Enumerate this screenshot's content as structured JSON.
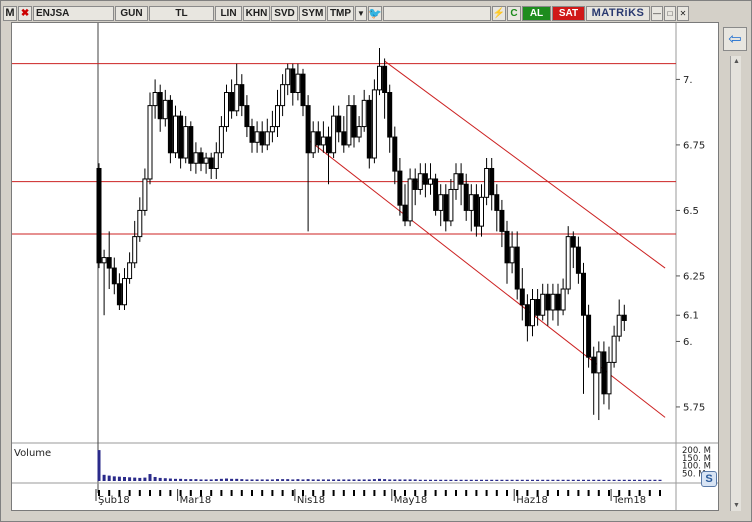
{
  "toolbar": {
    "logo": "M",
    "close_glyph": "✖",
    "symbol": "ENJSA",
    "period": "GUN",
    "currency": "TL",
    "scale_lin": "LIN",
    "khn": "KHN",
    "svd": "SVD",
    "sym": "SYM",
    "tmp": "TMP",
    "dropdown_glyph": "▼",
    "twitter_glyph": "🐦",
    "flash_glyph": "⚡",
    "refresh_glyph": "C",
    "buy_label": "AL",
    "sell_label": "SAT",
    "brand": "MATRiKS",
    "win_min": "—",
    "win_max": "□",
    "win_close": "✕"
  },
  "side_button_glyph": "⇦",
  "zoom_glyph": "S",
  "colors": {
    "candle": "#000000",
    "support_lines": "#cc2222",
    "channel_lines": "#cc2222",
    "volume_bars": "#2a2a8a",
    "grid": "#c0c0c0"
  },
  "chart_data": {
    "type": "candlestick",
    "price_axis": {
      "ticks": [
        7.0,
        6.75,
        6.5,
        6.25,
        6.1,
        6.0,
        5.75
      ],
      "tick_labels": [
        "7.",
        "6.75",
        "6.5",
        "6.25",
        "6.1",
        "6.",
        "5.75"
      ],
      "ylim": [
        5.62,
        7.2
      ]
    },
    "time_axis": {
      "labels": [
        "Şub18",
        "Mar18",
        "Nis18",
        "May18",
        "Haz18",
        "Tem18"
      ],
      "n_sessions": 111
    },
    "horizontal_levels": [
      7.06,
      6.61,
      6.41
    ],
    "channel": {
      "upper": [
        [
          56,
          7.07
        ],
        [
          111,
          6.28
        ]
      ],
      "lower": [
        [
          41,
          6.77
        ],
        [
          111,
          5.71
        ]
      ]
    },
    "candles": [
      [
        6.66,
        6.3,
        6.68,
        6.28
      ],
      [
        6.3,
        6.32,
        6.35,
        6.1
      ],
      [
        6.32,
        6.28,
        6.42,
        6.2
      ],
      [
        6.28,
        6.22,
        6.32,
        6.18
      ],
      [
        6.22,
        6.14,
        6.26,
        6.12
      ],
      [
        6.14,
        6.24,
        6.28,
        6.12
      ],
      [
        6.24,
        6.3,
        6.34,
        6.22
      ],
      [
        6.3,
        6.4,
        6.46,
        6.28
      ],
      [
        6.4,
        6.5,
        6.55,
        6.38
      ],
      [
        6.5,
        6.62,
        6.66,
        6.48
      ],
      [
        6.62,
        6.9,
        6.95,
        6.6
      ],
      [
        6.9,
        6.95,
        7.0,
        6.85
      ],
      [
        6.95,
        6.85,
        6.98,
        6.8
      ],
      [
        6.85,
        6.92,
        6.96,
        6.82
      ],
      [
        6.92,
        6.72,
        6.94,
        6.68
      ],
      [
        6.72,
        6.86,
        6.9,
        6.7
      ],
      [
        6.86,
        6.7,
        6.88,
        6.66
      ],
      [
        6.7,
        6.82,
        6.86,
        6.68
      ],
      [
        6.82,
        6.68,
        6.84,
        6.65
      ],
      [
        6.68,
        6.72,
        6.76,
        6.64
      ],
      [
        6.72,
        6.68,
        6.74,
        6.65
      ],
      [
        6.68,
        6.7,
        6.72,
        6.64
      ],
      [
        6.7,
        6.66,
        6.72,
        6.62
      ],
      [
        6.66,
        6.72,
        6.76,
        6.62
      ],
      [
        6.72,
        6.82,
        6.86,
        6.7
      ],
      [
        6.82,
        6.95,
        6.98,
        6.8
      ],
      [
        6.95,
        6.88,
        7.0,
        6.85
      ],
      [
        6.88,
        6.98,
        7.06,
        6.86
      ],
      [
        6.98,
        6.9,
        7.02,
        6.86
      ],
      [
        6.9,
        6.82,
        6.94,
        6.78
      ],
      [
        6.82,
        6.76,
        6.85,
        6.72
      ],
      [
        6.76,
        6.8,
        6.84,
        6.72
      ],
      [
        6.8,
        6.75,
        6.84,
        6.72
      ],
      [
        6.75,
        6.8,
        6.85,
        6.73
      ],
      [
        6.8,
        6.82,
        6.88,
        6.76
      ],
      [
        6.82,
        6.9,
        6.96,
        6.78
      ],
      [
        6.9,
        6.98,
        7.02,
        6.86
      ],
      [
        6.98,
        7.04,
        7.06,
        6.94
      ],
      [
        7.04,
        6.95,
        7.06,
        6.9
      ],
      [
        6.95,
        7.02,
        7.06,
        6.92
      ],
      [
        7.02,
        6.9,
        7.04,
        6.86
      ],
      [
        6.9,
        6.72,
        6.94,
        6.42
      ],
      [
        6.72,
        6.8,
        6.84,
        6.7
      ],
      [
        6.8,
        6.75,
        6.84,
        6.72
      ],
      [
        6.75,
        6.78,
        6.84,
        6.72
      ],
      [
        6.78,
        6.72,
        6.82,
        6.6
      ],
      [
        6.72,
        6.86,
        6.9,
        6.7
      ],
      [
        6.86,
        6.8,
        6.9,
        6.76
      ],
      [
        6.8,
        6.75,
        6.86,
        6.72
      ],
      [
        6.75,
        6.9,
        6.94,
        6.74
      ],
      [
        6.9,
        6.78,
        6.94,
        6.74
      ],
      [
        6.78,
        6.82,
        6.86,
        6.76
      ],
      [
        6.82,
        6.92,
        6.96,
        6.8
      ],
      [
        6.92,
        6.7,
        6.94,
        6.66
      ],
      [
        6.7,
        6.96,
        7.0,
        6.68
      ],
      [
        6.96,
        7.05,
        7.12,
        6.94
      ],
      [
        7.05,
        6.95,
        7.08,
        6.85
      ],
      [
        6.95,
        6.78,
        6.98,
        6.72
      ],
      [
        6.78,
        6.65,
        6.82,
        6.6
      ],
      [
        6.65,
        6.52,
        6.7,
        6.48
      ],
      [
        6.52,
        6.46,
        6.6,
        6.44
      ],
      [
        6.46,
        6.62,
        6.66,
        6.44
      ],
      [
        6.62,
        6.58,
        6.66,
        6.52
      ],
      [
        6.58,
        6.64,
        6.68,
        6.56
      ],
      [
        6.64,
        6.6,
        6.68,
        6.55
      ],
      [
        6.6,
        6.62,
        6.68,
        6.56
      ],
      [
        6.62,
        6.5,
        6.64,
        6.48
      ],
      [
        6.5,
        6.56,
        6.6,
        6.44
      ],
      [
        6.56,
        6.46,
        6.6,
        6.42
      ],
      [
        6.46,
        6.58,
        6.62,
        6.44
      ],
      [
        6.58,
        6.64,
        6.68,
        6.54
      ],
      [
        6.64,
        6.6,
        6.68,
        6.52
      ],
      [
        6.6,
        6.5,
        6.64,
        6.46
      ],
      [
        6.5,
        6.56,
        6.6,
        6.42
      ],
      [
        6.56,
        6.44,
        6.6,
        6.4
      ],
      [
        6.44,
        6.55,
        6.6,
        6.4
      ],
      [
        6.55,
        6.66,
        6.7,
        6.52
      ],
      [
        6.66,
        6.56,
        6.7,
        6.5
      ],
      [
        6.56,
        6.5,
        6.6,
        6.42
      ],
      [
        6.5,
        6.42,
        6.54,
        6.36
      ],
      [
        6.42,
        6.3,
        6.46,
        6.22
      ],
      [
        6.3,
        6.36,
        6.42,
        6.26
      ],
      [
        6.36,
        6.2,
        6.42,
        6.16
      ],
      [
        6.2,
        6.14,
        6.28,
        6.08
      ],
      [
        6.14,
        6.06,
        6.18,
        6.0
      ],
      [
        6.06,
        6.16,
        6.2,
        6.02
      ],
      [
        6.16,
        6.1,
        6.2,
        6.06
      ],
      [
        6.1,
        6.18,
        6.22,
        6.08
      ],
      [
        6.18,
        6.12,
        6.22,
        6.06
      ],
      [
        6.12,
        6.18,
        6.22,
        6.08
      ],
      [
        6.18,
        6.12,
        6.22,
        6.06
      ],
      [
        6.12,
        6.2,
        6.24,
        6.1
      ],
      [
        6.2,
        6.4,
        6.44,
        6.18
      ],
      [
        6.4,
        6.36,
        6.42,
        6.28
      ],
      [
        6.36,
        6.26,
        6.4,
        6.22
      ],
      [
        6.26,
        6.1,
        6.3,
        5.8
      ],
      [
        6.1,
        5.94,
        6.14,
        5.9
      ],
      [
        5.94,
        5.88,
        5.98,
        5.72
      ],
      [
        5.88,
        5.96,
        6.0,
        5.7
      ],
      [
        5.96,
        5.8,
        6.0,
        5.76
      ],
      [
        5.8,
        5.92,
        5.98,
        5.74
      ],
      [
        5.92,
        6.02,
        6.06,
        5.9
      ],
      [
        6.02,
        6.1,
        6.16,
        6.0
      ],
      [
        6.1,
        6.08,
        6.14,
        6.04
      ]
    ],
    "volume_axis": {
      "tick_labels": [
        "200. M",
        "150. M",
        "100. M",
        "50. M"
      ],
      "ylim": [
        0,
        220
      ]
    },
    "volume_label": "Volume",
    "volumes": [
      200,
      40,
      35,
      30,
      28,
      26,
      24,
      22,
      20,
      22,
      45,
      26,
      20,
      18,
      16,
      14,
      14,
      12,
      12,
      12,
      10,
      10,
      10,
      12,
      14,
      16,
      14,
      14,
      12,
      10,
      10,
      10,
      10,
      10,
      10,
      12,
      12,
      12,
      10,
      12,
      10,
      12,
      10,
      10,
      10,
      10,
      10,
      10,
      10,
      10,
      10,
      10,
      10,
      10,
      12,
      14,
      12,
      10,
      10,
      10,
      10,
      10,
      10,
      8,
      8,
      8,
      8,
      8,
      8,
      8,
      8,
      8,
      8,
      8,
      8,
      8,
      8,
      8,
      8,
      8,
      8,
      8,
      8,
      8,
      8,
      8,
      8,
      8,
      8,
      8,
      8,
      8,
      8,
      8,
      8,
      8,
      8,
      8,
      8,
      8,
      8,
      8,
      8,
      8,
      8,
      8,
      8,
      8,
      8,
      8,
      8
    ]
  }
}
